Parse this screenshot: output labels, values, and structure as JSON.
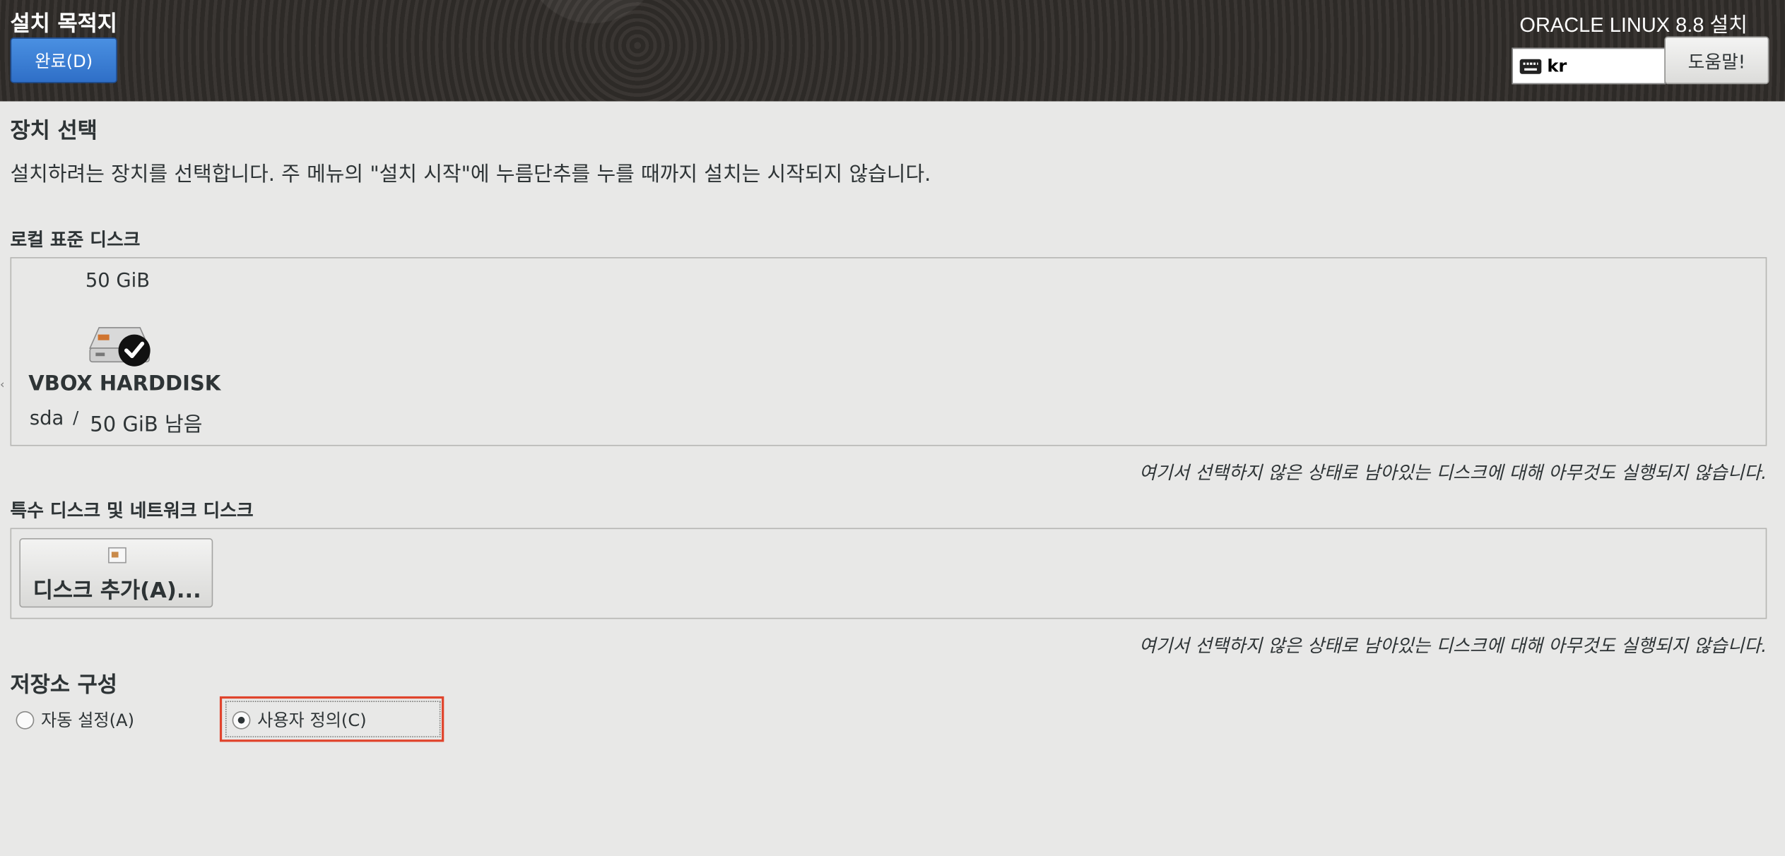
{
  "header": {
    "title": "설치 목적지",
    "done_button": "완료(D)",
    "product": "ORACLE LINUX 8.8 설치",
    "keyboard_layout": "kr",
    "help_button": "도움말!"
  },
  "device_selection": {
    "heading": "장치 선택",
    "description": "설치하려는 장치를 선택합니다. 주 메뉴의 \"설치 시작\"에 누름단추를 누를 때까지 설치는 시작되지 않습니다."
  },
  "local_disks": {
    "heading": "로컬 표준 디스크",
    "disks": [
      {
        "size": "50 GiB",
        "name": "VBOX HARDDISK",
        "device": "sda",
        "separator": "/",
        "free": "50 GiB 남음",
        "icon": "harddisk-selected-icon"
      }
    ],
    "note": "여기서 선택하지 않은 상태로 남아있는 디스크에 대해 아무것도 실행되지 않습니다."
  },
  "special_disks": {
    "heading": "특수 디스크 및 네트워크 디스크",
    "add_button": "디스크 추가(A)...",
    "note": "여기서 선택하지 않은 상태로 남아있는 디스크에 대해 아무것도 실행되지 않습니다."
  },
  "storage_config": {
    "heading": "저장소 구성",
    "options": [
      {
        "label": "자동 설정(A)",
        "selected": false
      },
      {
        "label": "사용자 정의(C)",
        "selected": true
      }
    ]
  },
  "colors": {
    "accent_blue": "#3b7fd6",
    "highlight_red": "#e0442c"
  }
}
